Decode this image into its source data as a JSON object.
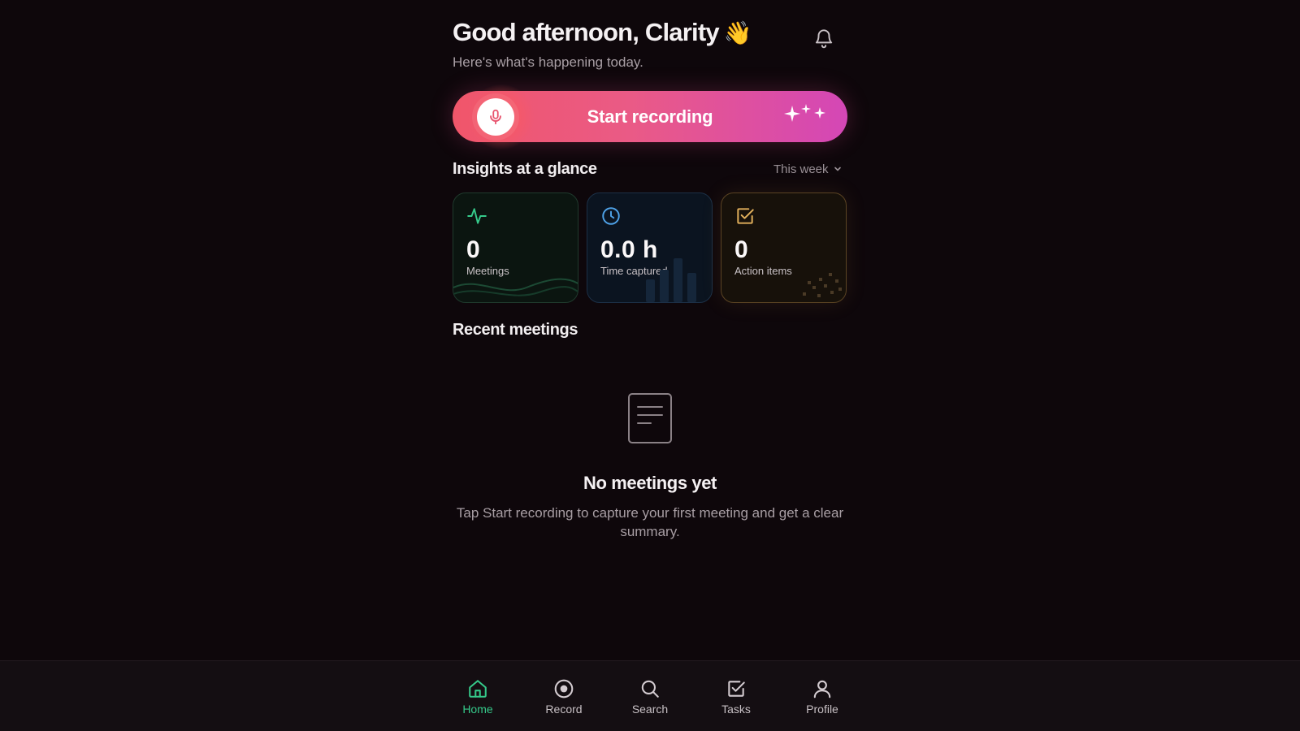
{
  "header": {
    "greeting": "Good afternoon, Clarity",
    "greeting_emoji": "👋",
    "subtitle": "Here's what's happening today."
  },
  "record_button": {
    "label": "Start recording"
  },
  "insights": {
    "title": "Insights at a glance",
    "range": "This week",
    "cards": [
      {
        "value": "0",
        "label": "Meetings",
        "icon": "activity-icon",
        "color": "#35c98a"
      },
      {
        "value": "0.0 h",
        "label": "Time captured",
        "icon": "clock-icon",
        "color": "#4ea1e6"
      },
      {
        "value": "0",
        "label": "Action items",
        "icon": "checkbox-icon",
        "color": "#e2b05c"
      }
    ]
  },
  "recent_meetings": {
    "title": "Recent meetings",
    "empty_title": "No meetings yet",
    "empty_description": "Tap Start recording to capture your first meeting and get a clear summary."
  },
  "nav": {
    "items": [
      {
        "label": "Home",
        "icon": "home-icon",
        "active": true
      },
      {
        "label": "Record",
        "icon": "record-icon",
        "active": false
      },
      {
        "label": "Search",
        "icon": "search-icon",
        "active": false
      },
      {
        "label": "Tasks",
        "icon": "tasks-icon",
        "active": false
      },
      {
        "label": "Profile",
        "icon": "profile-icon",
        "active": false
      }
    ]
  },
  "colors": {
    "background": "#0e070b",
    "accent_active": "#35c98a",
    "record_gradient_start": "#f0566a",
    "record_gradient_end": "#d447b6"
  }
}
